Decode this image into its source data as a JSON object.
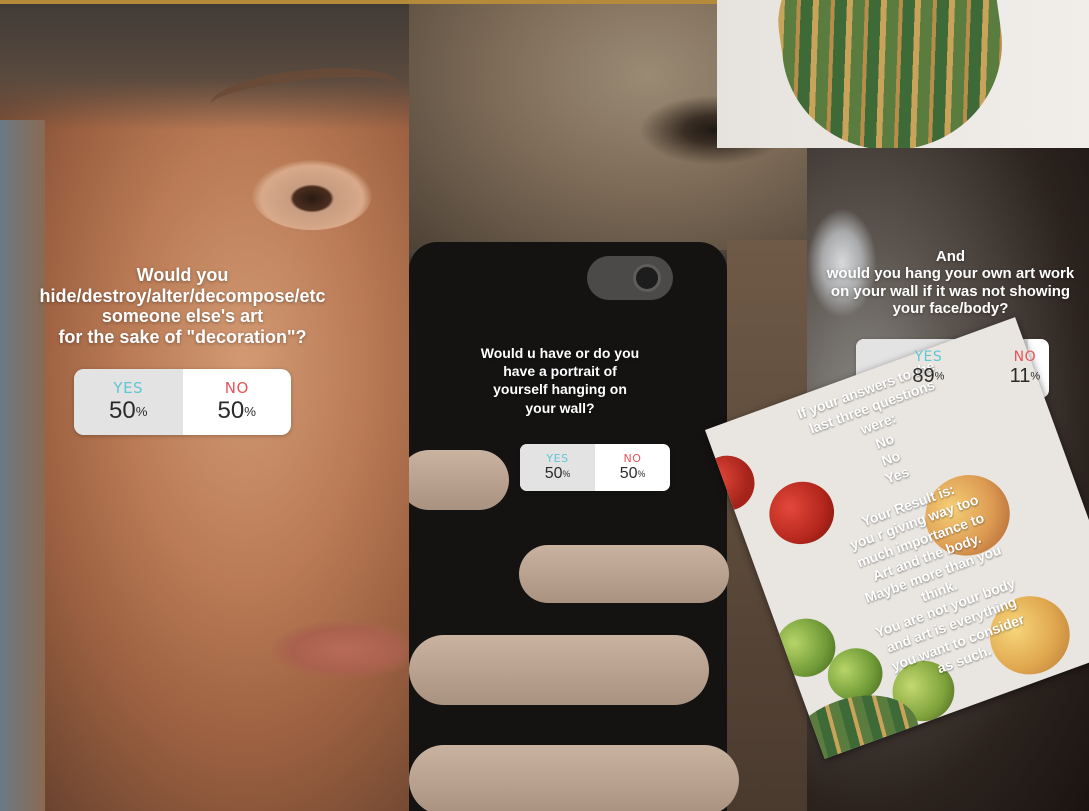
{
  "left_story": {
    "question": [
      "Would you",
      "hide/destroy/alter/decompose/etc",
      "someone else's art",
      "for the sake of \"decoration\"?"
    ],
    "poll": {
      "yes_label": "YES",
      "no_label": "NO",
      "yes_pct": "50",
      "no_pct": "50",
      "pct_sign": "%"
    }
  },
  "middle_story": {
    "question": [
      "Would u have or do you",
      "have a portrait of",
      "yourself hanging on",
      "your wall?"
    ],
    "poll": {
      "yes_label": "YES",
      "no_label": "NO",
      "yes_pct": "50",
      "no_pct": "50",
      "pct_sign": "%"
    }
  },
  "right_story": {
    "question": [
      "And",
      "would you hang your own art work",
      "on your wall if it was not showing",
      "your face/body?"
    ],
    "poll": {
      "yes_label": "YES",
      "no_label": "NO",
      "yes_pct": "89",
      "no_pct": "11",
      "pct_sign": "%",
      "yes_fraction": 0.89
    }
  },
  "result_card": {
    "lines": [
      "If your answers to the",
      "last three questions",
      "were:",
      "No",
      "No",
      "Yes",
      "",
      "Your Result is:",
      "you r giving way too",
      "much importance to",
      "Art and the body.",
      "Maybe more than you",
      "think.",
      "You are not your body",
      "and art is everything",
      "you want to consider",
      "as such."
    ]
  },
  "colors": {
    "yes": "#5fc6d6",
    "no": "#e8545a",
    "poll_bg": "#ffffff",
    "poll_win_bg": "#e3e3e3"
  }
}
